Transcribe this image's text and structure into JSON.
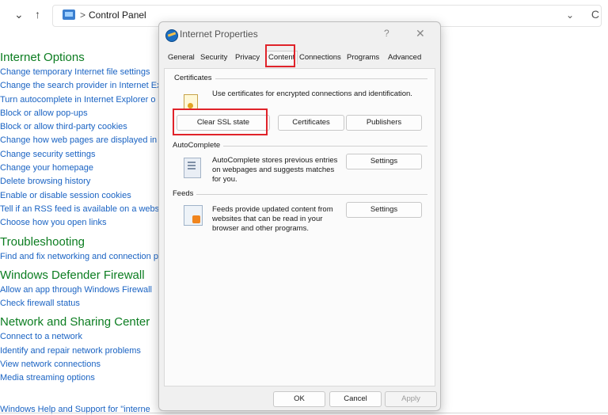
{
  "address": {
    "path_label": "Control Panel",
    "separator": ">"
  },
  "nav": {
    "down_arrow": "⌄",
    "up_arrow": "↑",
    "chevron": "⌄",
    "refresh": "C"
  },
  "sections": [
    {
      "title": "Internet Options",
      "links": [
        "Change temporary Internet file settings",
        "Change the search provider in Internet Ex",
        "Turn autocomplete in Internet Explorer o",
        "Block or allow pop-ups",
        "Block or allow third-party cookies",
        "Change how web pages are displayed in",
        "Change security settings",
        "Change your homepage",
        "Delete browsing history",
        "Enable or disable session cookies",
        "Tell if an RSS feed is available on a webs",
        "Choose how you open links"
      ]
    },
    {
      "title": "Troubleshooting",
      "links": [
        "Find and fix networking and connection p"
      ]
    },
    {
      "title": "Windows Defender Firewall",
      "links": [
        "Allow an app through Windows Firewall",
        "Check firewall status"
      ]
    },
    {
      "title": "Network and Sharing Center",
      "links": [
        "Connect to a network",
        "Identify and repair network problems",
        "View network connections",
        "Media streaming options"
      ]
    }
  ],
  "bottom_link": "Windows Help and Support for \"interne",
  "dialog": {
    "title": "Internet Properties",
    "help": "?",
    "close": "✕",
    "tabs": [
      "General",
      "Security",
      "Privacy",
      "Content",
      "Connections",
      "Programs",
      "Advanced"
    ],
    "active_tab": "Content",
    "certificates": {
      "label": "Certificates",
      "description": "Use certificates for encrypted connections and identification.",
      "buttons": {
        "clear_ssl": "Clear SSL state",
        "certificates": "Certificates",
        "publishers": "Publishers"
      }
    },
    "autocomplete": {
      "label": "AutoComplete",
      "description_lines": [
        "AutoComplete stores previous entries",
        "on webpages and suggests matches",
        "for you."
      ],
      "settings": "Settings"
    },
    "feeds": {
      "label": "Feeds",
      "description_lines": [
        "Feeds provide updated content from",
        "websites that can be read in your",
        "browser and other programs."
      ],
      "settings": "Settings"
    },
    "footer": {
      "ok": "OK",
      "cancel": "Cancel",
      "apply": "Apply"
    }
  }
}
